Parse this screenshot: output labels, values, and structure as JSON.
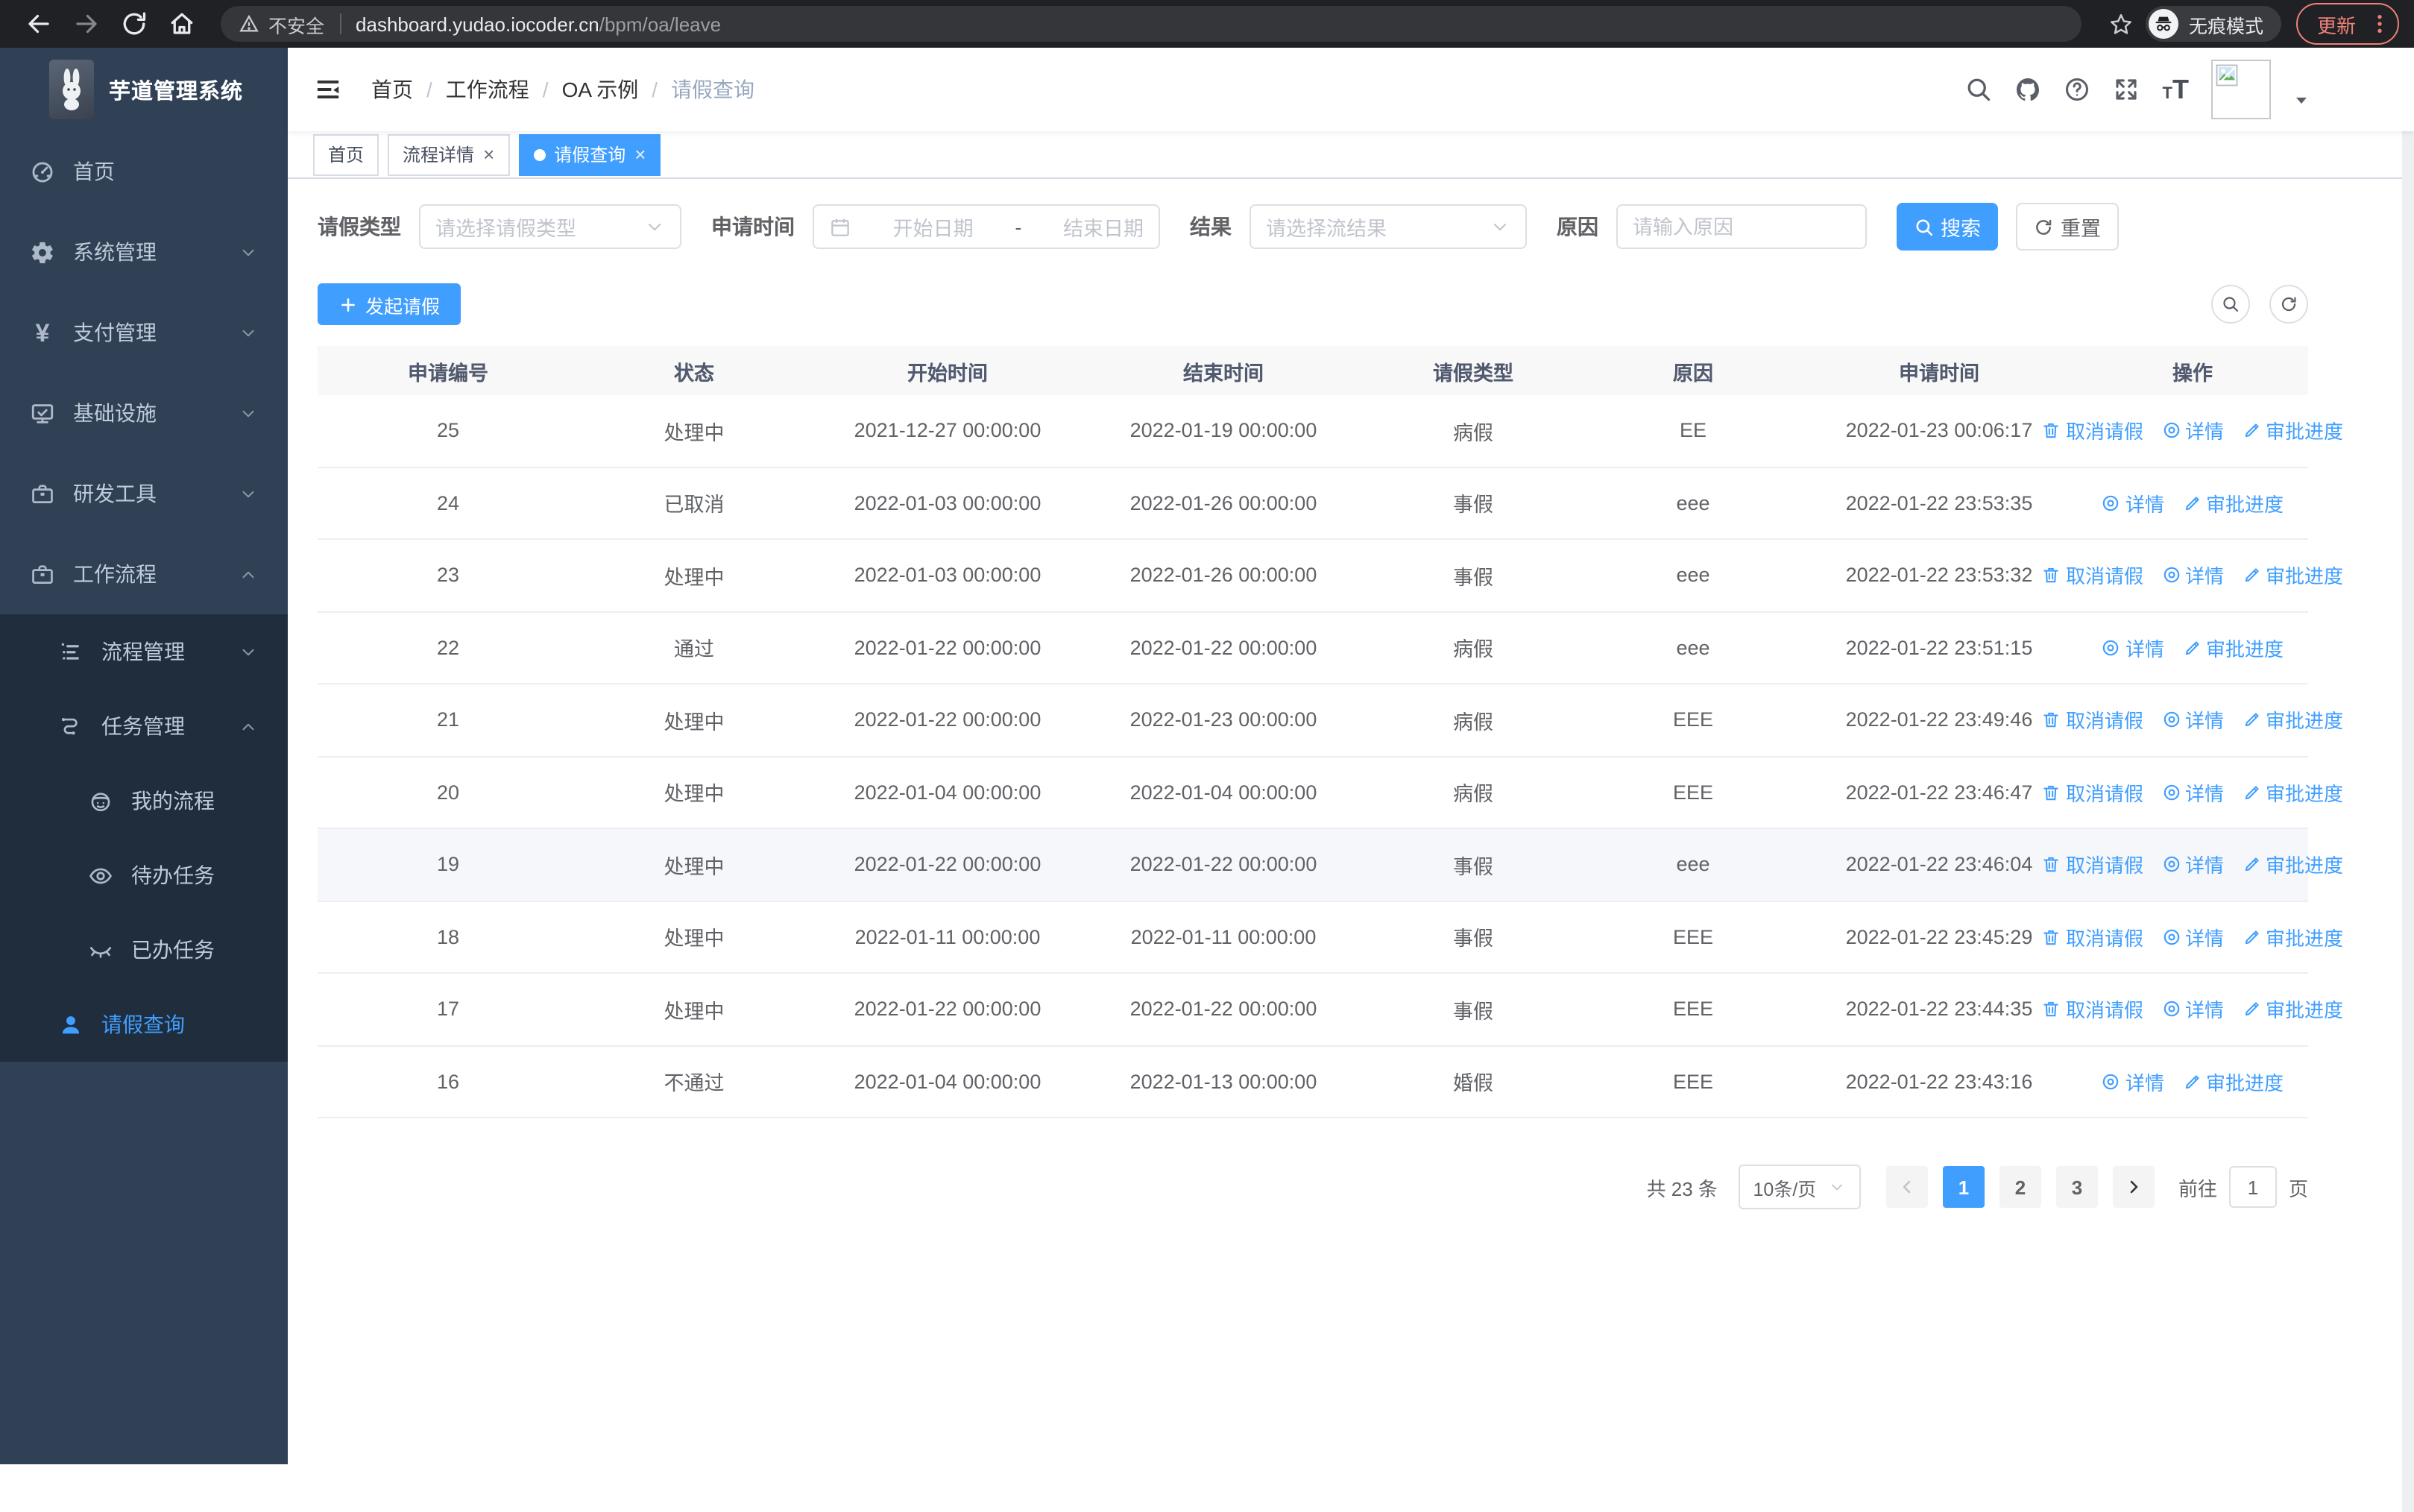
{
  "browser": {
    "security_label": "不安全",
    "url_host": "dashboard.yudao.iocoder.cn",
    "url_path": "/bpm/oa/leave",
    "incognito_label": "无痕模式",
    "update_label": "更新"
  },
  "sidebar": {
    "logo_title": "芋道管理系统",
    "menu": [
      {
        "key": "home",
        "label": "首页",
        "icon": "dashboard-icon",
        "depth": 0,
        "sub": false,
        "active": false,
        "chevron": null
      },
      {
        "key": "system",
        "label": "系统管理",
        "icon": "gear-icon",
        "depth": 0,
        "sub": false,
        "active": false,
        "chevron": "down"
      },
      {
        "key": "payment",
        "label": "支付管理",
        "icon": "yen-icon",
        "depth": 0,
        "sub": false,
        "active": false,
        "chevron": "down"
      },
      {
        "key": "infrastructure",
        "label": "基础设施",
        "icon": "monitor-icon",
        "depth": 0,
        "sub": false,
        "active": false,
        "chevron": "down"
      },
      {
        "key": "dev-tools",
        "label": "研发工具",
        "icon": "toolbox-icon",
        "depth": 0,
        "sub": false,
        "active": false,
        "chevron": "down"
      },
      {
        "key": "workflow",
        "label": "工作流程",
        "icon": "toolbox-icon",
        "depth": 0,
        "sub": false,
        "active": false,
        "chevron": "up"
      },
      {
        "key": "process-mgmt",
        "label": "流程管理",
        "icon": "list-icon",
        "depth": 1,
        "sub": true,
        "active": false,
        "chevron": "down"
      },
      {
        "key": "task-mgmt",
        "label": "任务管理",
        "icon": "flow-icon",
        "depth": 1,
        "sub": true,
        "active": false,
        "chevron": "up"
      },
      {
        "key": "my-process",
        "label": "我的流程",
        "icon": "robot-icon",
        "depth": 2,
        "sub": true,
        "active": false,
        "chevron": null
      },
      {
        "key": "todo-tasks",
        "label": "待办任务",
        "icon": "eye-icon",
        "depth": 2,
        "sub": true,
        "active": false,
        "chevron": null
      },
      {
        "key": "done-tasks",
        "label": "已办任务",
        "icon": "eye-closed-icon",
        "depth": 2,
        "sub": true,
        "active": false,
        "chevron": null
      },
      {
        "key": "leave-query",
        "label": "请假查询",
        "icon": "user-icon",
        "depth": 1,
        "sub": true,
        "active": true,
        "chevron": null
      }
    ]
  },
  "navbar": {
    "breadcrumb": [
      "首页",
      "工作流程",
      "OA 示例",
      "请假查询"
    ]
  },
  "tabs": [
    {
      "key": "home-tab",
      "label": "首页",
      "closable": false,
      "active": false
    },
    {
      "key": "process-detail-tab",
      "label": "流程详情",
      "closable": true,
      "active": false
    },
    {
      "key": "leave-query-tab",
      "label": "请假查询",
      "closable": true,
      "active": true
    }
  ],
  "filters": {
    "leave_type_label": "请假类型",
    "leave_type_placeholder": "请选择请假类型",
    "apply_time_label": "申请时间",
    "date_start_placeholder": "开始日期",
    "date_separator": "-",
    "date_end_placeholder": "结束日期",
    "result_label": "结果",
    "result_placeholder": "请选择流结果",
    "reason_label": "原因",
    "reason_placeholder": "请输入原因",
    "search_label": "搜索",
    "reset_label": "重置"
  },
  "toolbar": {
    "create_label": "发起请假"
  },
  "table": {
    "headers": [
      "申请编号",
      "状态",
      "开始时间",
      "结束时间",
      "请假类型",
      "原因",
      "申请时间",
      "操作"
    ],
    "action_labels": {
      "cancel": "取消请假",
      "detail": "详情",
      "progress": "审批进度"
    },
    "rows": [
      {
        "id": "25",
        "status": "处理中",
        "start": "2021-12-27 00:00:00",
        "end": "2022-01-19 00:00:00",
        "type": "病假",
        "reason": "EE",
        "apply_time": "2022-01-23 00:06:17",
        "actions": [
          "cancel",
          "detail",
          "progress"
        ],
        "highlighted": false
      },
      {
        "id": "24",
        "status": "已取消",
        "start": "2022-01-03 00:00:00",
        "end": "2022-01-26 00:00:00",
        "type": "事假",
        "reason": "eee",
        "apply_time": "2022-01-22 23:53:35",
        "actions": [
          "detail",
          "progress"
        ],
        "highlighted": false
      },
      {
        "id": "23",
        "status": "处理中",
        "start": "2022-01-03 00:00:00",
        "end": "2022-01-26 00:00:00",
        "type": "事假",
        "reason": "eee",
        "apply_time": "2022-01-22 23:53:32",
        "actions": [
          "cancel",
          "detail",
          "progress"
        ],
        "highlighted": false
      },
      {
        "id": "22",
        "status": "通过",
        "start": "2022-01-22 00:00:00",
        "end": "2022-01-22 00:00:00",
        "type": "病假",
        "reason": "eee",
        "apply_time": "2022-01-22 23:51:15",
        "actions": [
          "detail",
          "progress"
        ],
        "highlighted": false
      },
      {
        "id": "21",
        "status": "处理中",
        "start": "2022-01-22 00:00:00",
        "end": "2022-01-23 00:00:00",
        "type": "病假",
        "reason": "EEE",
        "apply_time": "2022-01-22 23:49:46",
        "actions": [
          "cancel",
          "detail",
          "progress"
        ],
        "highlighted": false
      },
      {
        "id": "20",
        "status": "处理中",
        "start": "2022-01-04 00:00:00",
        "end": "2022-01-04 00:00:00",
        "type": "病假",
        "reason": "EEE",
        "apply_time": "2022-01-22 23:46:47",
        "actions": [
          "cancel",
          "detail",
          "progress"
        ],
        "highlighted": false
      },
      {
        "id": "19",
        "status": "处理中",
        "start": "2022-01-22 00:00:00",
        "end": "2022-01-22 00:00:00",
        "type": "事假",
        "reason": "eee",
        "apply_time": "2022-01-22 23:46:04",
        "actions": [
          "cancel",
          "detail",
          "progress"
        ],
        "highlighted": true
      },
      {
        "id": "18",
        "status": "处理中",
        "start": "2022-01-11 00:00:00",
        "end": "2022-01-11 00:00:00",
        "type": "事假",
        "reason": "EEE",
        "apply_time": "2022-01-22 23:45:29",
        "actions": [
          "cancel",
          "detail",
          "progress"
        ],
        "highlighted": false
      },
      {
        "id": "17",
        "status": "处理中",
        "start": "2022-01-22 00:00:00",
        "end": "2022-01-22 00:00:00",
        "type": "事假",
        "reason": "EEE",
        "apply_time": "2022-01-22 23:44:35",
        "actions": [
          "cancel",
          "detail",
          "progress"
        ],
        "highlighted": false
      },
      {
        "id": "16",
        "status": "不通过",
        "start": "2022-01-04 00:00:00",
        "end": "2022-01-13 00:00:00",
        "type": "婚假",
        "reason": "EEE",
        "apply_time": "2022-01-22 23:43:16",
        "actions": [
          "detail",
          "progress"
        ],
        "highlighted": false
      }
    ]
  },
  "pagination": {
    "total_label": "共 23 条",
    "page_size": "10条/页",
    "pages": [
      "1",
      "2",
      "3"
    ],
    "active_page": "1",
    "goto_label": "前往",
    "goto_value": "1",
    "page_unit": "页"
  },
  "colors": {
    "accent": "#409eff",
    "sidebar_bg": "#304156",
    "submenu_bg": "#1f2d3d",
    "browser_bar_bg": "#202124",
    "update_accent": "#ef8078",
    "table_header_bg": "#f8f8f9",
    "row_highlight": "#f5f7fa"
  }
}
